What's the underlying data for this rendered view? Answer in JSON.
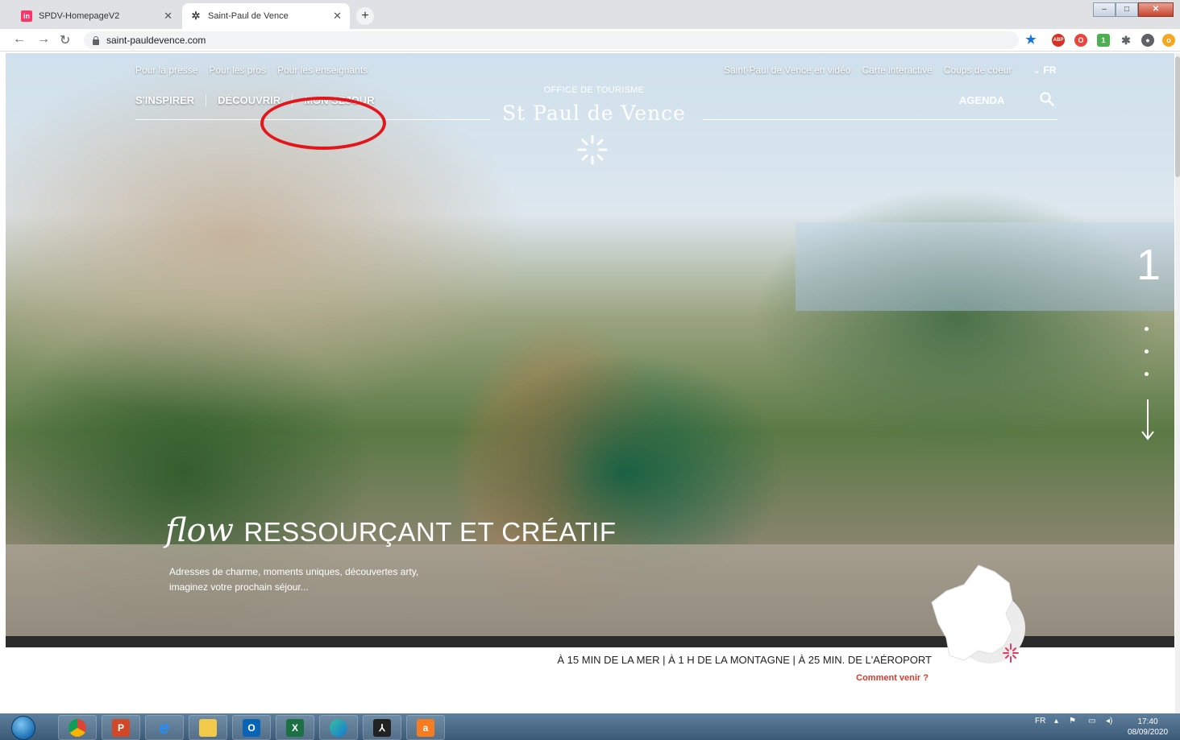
{
  "browser": {
    "tabs": [
      {
        "label": "SPDV-HomepageV2",
        "favicon": "in"
      },
      {
        "label": "Saint-Paul de Vence"
      }
    ],
    "url": "saint-pauldevence.com"
  },
  "site": {
    "top_links": [
      "Pour la presse",
      "Pour les pros",
      "Pour les enseignants"
    ],
    "top_links_right": [
      "Saint-Paul de Vence en vidéo",
      "Carte interactive",
      "Coups de coeur"
    ],
    "language": "FR",
    "main_menu": [
      "S'INSPIRER",
      "DÉCOUVRIR",
      "MON SÉJOUR"
    ],
    "agenda": "AGENDA",
    "logo_subtitle": "OFFICE DE TOURISME",
    "logo": "St Paul de Vence",
    "hero": {
      "script_word": "flow",
      "headline": "RESSOURÇANT ET CRÉATIF",
      "description": "Adresses de charme, moments uniques, découvertes arty, imaginez votre prochain séjour..."
    },
    "slider_number": "1",
    "tagline": "À 15 MIN DE LA MER | À 1 H DE LA MONTAGNE | À 25 MIN. DE L'AÉROPORT",
    "directions_link": "Comment venir ?"
  },
  "taskbar": {
    "language": "FR",
    "time": "17:40",
    "date": "08/09/2020"
  },
  "colors": {
    "highlight_circle": "#e4161b",
    "link_red": "#d83a2b"
  }
}
